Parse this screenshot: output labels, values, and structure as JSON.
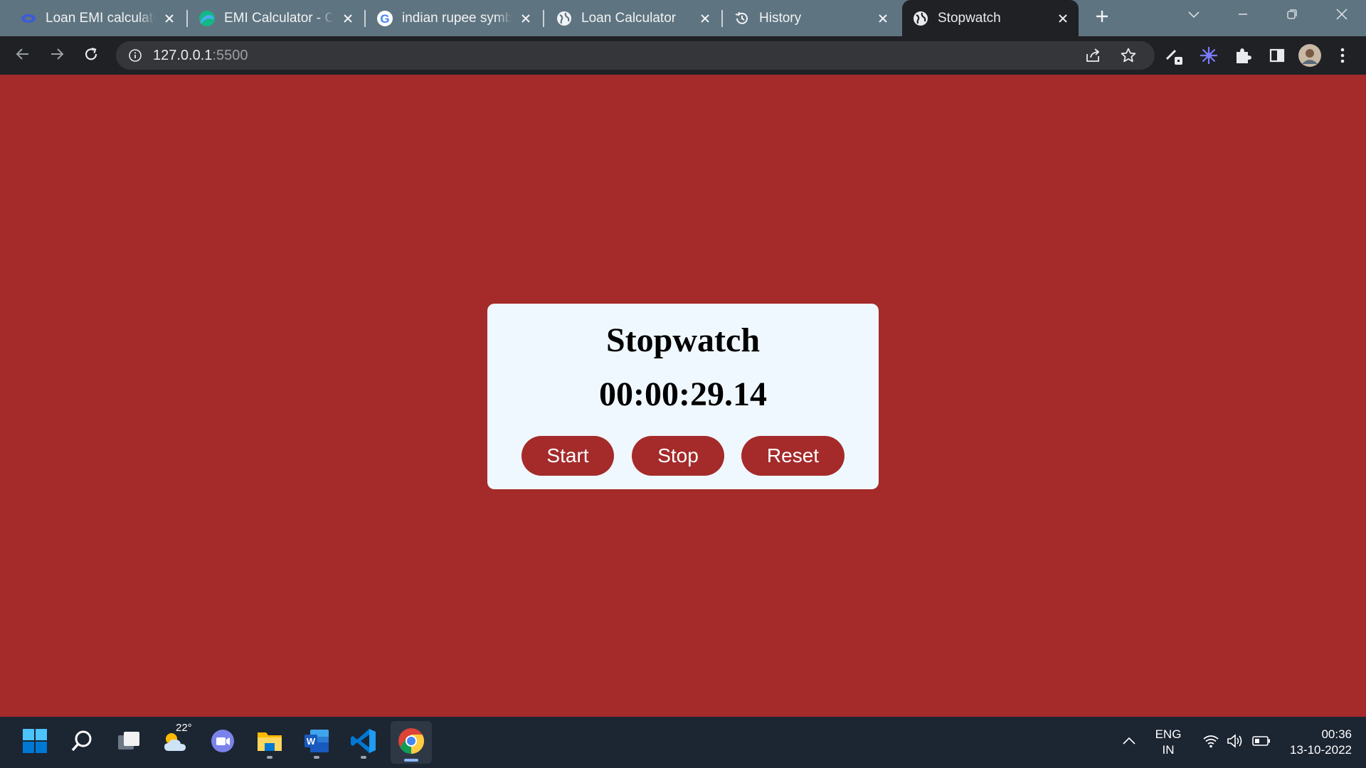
{
  "browser": {
    "tabs": [
      {
        "title": "Loan EMI calculator",
        "icon": "emi-blue-icon",
        "active": false
      },
      {
        "title": "EMI Calculator - Calculate EMI",
        "icon": "emi-calculator-icon",
        "active": false
      },
      {
        "title": "indian rupee symbol",
        "icon": "google-icon",
        "active": false
      },
      {
        "title": "Loan Calculator",
        "icon": "globe-icon",
        "active": false
      },
      {
        "title": "History",
        "icon": "history-icon",
        "active": false
      },
      {
        "title": "Stopwatch",
        "icon": "globe-icon",
        "active": true
      }
    ],
    "url_host": "127.0.0.1",
    "url_port": ":5500"
  },
  "page": {
    "heading": "Stopwatch",
    "time": "00:00:29.14",
    "buttons": {
      "start": "Start",
      "stop": "Stop",
      "reset": "Reset"
    },
    "colors": {
      "background": "#a52a2a",
      "card": "#f0f8ff",
      "button": "#a52a2a"
    }
  },
  "taskbar": {
    "weather_temp": "22°",
    "language": "ENG",
    "region": "IN",
    "clock_time": "00:36",
    "clock_date": "13-10-2022"
  }
}
